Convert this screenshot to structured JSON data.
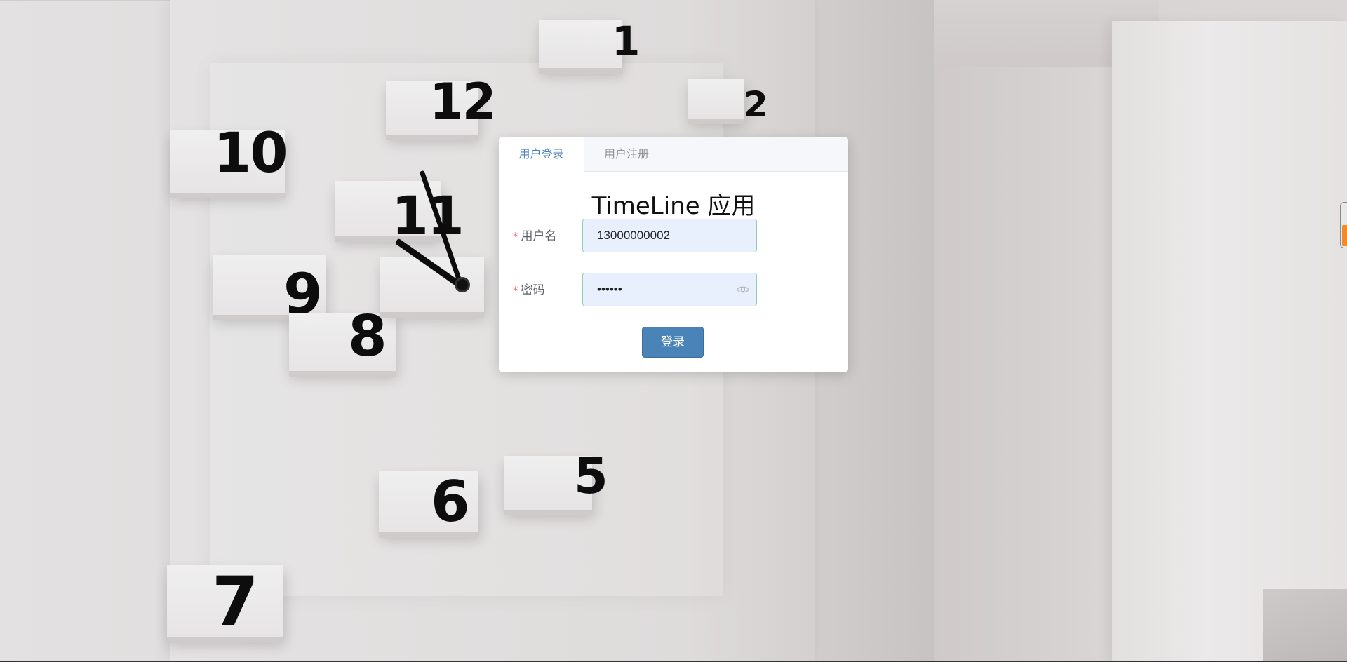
{
  "tabs": {
    "login": "用户登录",
    "register": "用户注册"
  },
  "app_title": "TimeLine 应用",
  "form": {
    "required_mark": "*",
    "username_label": "用户名",
    "username_value": "13000000002",
    "password_label": "密码",
    "password_value": "123456",
    "submit_label": "登录"
  },
  "clock": {
    "numbers": [
      "1",
      "2",
      "12",
      "10",
      "11",
      "9",
      "8",
      "6",
      "5",
      "7"
    ]
  },
  "colors": {
    "accent": "#4a83b7",
    "required": "#f56c6c",
    "input_bg": "#e8f0fe",
    "input_border": "#8fd3a8"
  },
  "icons": {
    "password_toggle": "eye-icon"
  }
}
